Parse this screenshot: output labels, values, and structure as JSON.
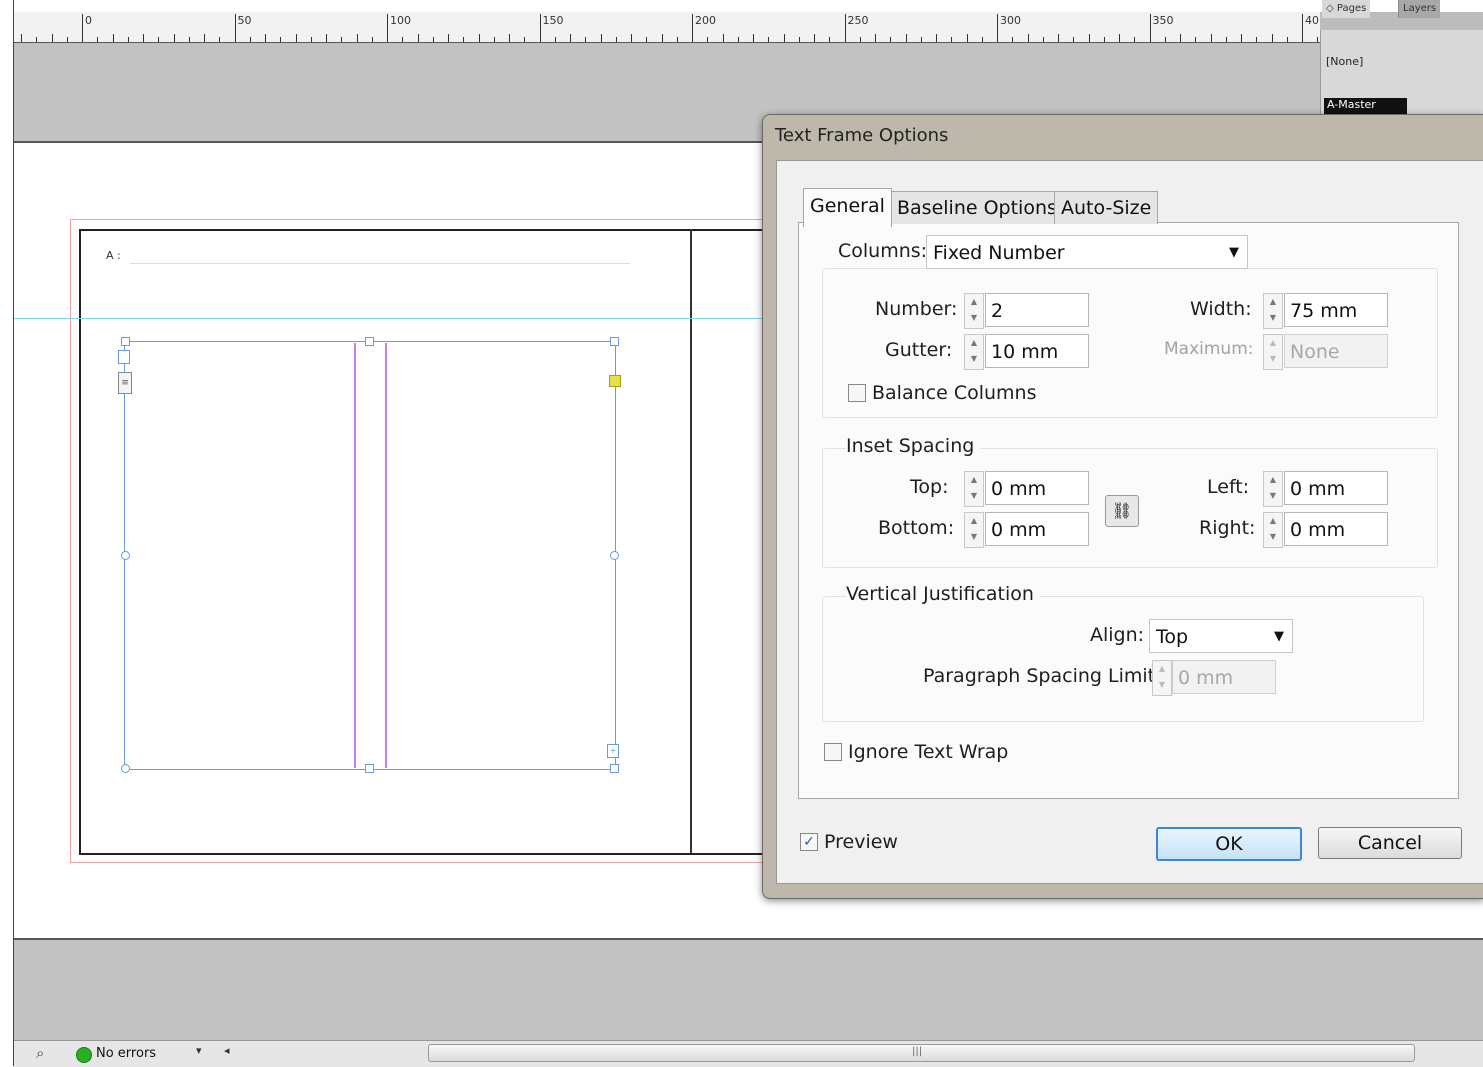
{
  "ruler": {
    "labels": [
      "0",
      "50",
      "100",
      "150",
      "200",
      "250",
      "300",
      "350",
      "40"
    ]
  },
  "pages_panel": {
    "tabs": [
      "◇ Pages",
      "Layers"
    ],
    "none_label": "[None]",
    "master_label": "A-Master"
  },
  "page": {
    "master_prefix": "A :"
  },
  "dialog": {
    "title": "Text Frame Options",
    "tabs": [
      "General",
      "Baseline Options",
      "Auto-Size"
    ],
    "columns": {
      "label": "Columns:",
      "value": "Fixed Number",
      "number_label": "Number:",
      "number_value": "2",
      "gutter_label": "Gutter:",
      "gutter_value": "10 mm",
      "width_label": "Width:",
      "width_value": "75 mm",
      "maximum_label": "Maximum:",
      "maximum_value": "None",
      "balance_label": "Balance Columns",
      "balance_checked": false
    },
    "inset": {
      "heading": "Inset Spacing",
      "top_label": "Top:",
      "top_value": "0 mm",
      "bottom_label": "Bottom:",
      "bottom_value": "0 mm",
      "left_label": "Left:",
      "left_value": "0 mm",
      "right_label": "Right:",
      "right_value": "0 mm"
    },
    "vertical": {
      "heading": "Vertical Justification",
      "align_label": "Align:",
      "align_value": "Top",
      "spacing_label": "Paragraph Spacing Limit:",
      "spacing_value": "0 mm"
    },
    "ignore_wrap_label": "Ignore Text Wrap",
    "ignore_wrap_checked": false,
    "preview_label": "Preview",
    "preview_checked": true,
    "ok_label": "OK",
    "cancel_label": "Cancel"
  },
  "statusbar": {
    "errors_text": "No errors",
    "status_color": "#27b024"
  },
  "colors": {
    "frame_blue": "#6699e6",
    "column_guide": "#c87fe8",
    "guide_cyan": "#7dd9e8",
    "bleed_red": "#f0a0a0",
    "ok_border": "#3b87d6"
  }
}
